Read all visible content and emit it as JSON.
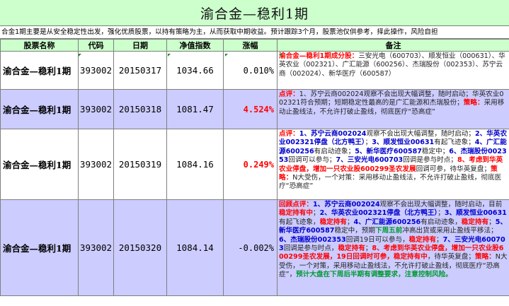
{
  "title": "渝合金—稳利1期",
  "description": "合金1期主要是从安全稳定性出发，强化优质股票，以持有策略为主，从而获取中期收益。预计跟踪3个月，股票池仅供参考，择此操作，风险自担",
  "headers": [
    "股票名称",
    "代码",
    "日期",
    "净值指数",
    "涨幅",
    "备注"
  ],
  "rows": [
    {
      "name": "渝合金—稳利1期",
      "code": "393002",
      "date": "20150317",
      "index": "1034.66",
      "change": "0.010%",
      "note": [
        {
          "t": "渝合金—稳利1期成分股：",
          "c": "red"
        },
        {
          "t": "三安光电（600703）、顺发恒业（000631）、华英农业（002321）、广汇能源（600256）、杰瑞股份（002353）、苏宁云商（002024）、新华医疗（600587）",
          "c": "plain"
        }
      ]
    },
    {
      "name": "渝合金—稳利1期",
      "code": "393002",
      "date": "20150318",
      "index": "1081.47",
      "change": "4.524%",
      "note": [
        {
          "t": "点评：",
          "c": "red"
        },
        {
          "t": "1、苏宁云商002024观察不会出现大幅调整，随时启动；华英农业002321符合预期；短期稳定性最高的是广汇能源和杰瑞股份；",
          "c": "plain"
        },
        {
          "t": "策略：",
          "c": "red"
        },
        {
          "t": "采用移动止盈线法，不允许打破止盈线，彻底医疗“恐高症”",
          "c": "plain"
        }
      ]
    },
    {
      "name": "渝合金—稳利1期",
      "code": "393002",
      "date": "20150319",
      "index": "1084.16",
      "change": "0.249%",
      "note": [
        {
          "t": "点评：",
          "c": "red"
        },
        {
          "t": "1、苏宁云商002024",
          "c": "blue"
        },
        {
          "t": "观察不会出现大幅调整，随时启动；",
          "c": "plain"
        },
        {
          "t": "2、华英农业002321停盘（北方鸭王）",
          "c": "blue"
        },
        {
          "t": "；",
          "c": "plain"
        },
        {
          "t": "3、顺发恒业00631",
          "c": "blue"
        },
        {
          "t": "有起飞迹象；",
          "c": "plain"
        },
        {
          "t": "4、广汇能源600256",
          "c": "blue"
        },
        {
          "t": "有启动迹象；",
          "c": "plain"
        },
        {
          "t": "5、新华医疗600587",
          "c": "blue"
        },
        {
          "t": "稳定中；",
          "c": "plain"
        },
        {
          "t": "6、杰瑞股份002353",
          "c": "blue"
        },
        {
          "t": "回调可以参与；",
          "c": "plain"
        },
        {
          "t": "7、三安光电600703",
          "c": "blue"
        },
        {
          "t": "回调是参与时点；",
          "c": "plain"
        },
        {
          "t": "8、考虑到华英农业停盘，增加一只农业股600299圣农发展",
          "c": "red"
        },
        {
          "t": "回调可参，待华英复盘；",
          "c": "plain"
        },
        {
          "t": "策略：",
          "c": "red"
        },
        {
          "t": "N大受伤，一个对策：采用移动止盈线法，不允许打破止盈线，彻底医疗“恐高症”",
          "c": "plain"
        }
      ]
    },
    {
      "name": "渝合金—稳利1期",
      "code": "393002",
      "date": "20150320",
      "index": "1084.14",
      "change": "-0.002%",
      "note": [
        {
          "t": "回顾点评：",
          "c": "red"
        },
        {
          "t": "1、苏宁云商002024",
          "c": "blue"
        },
        {
          "t": "观察不会出现大幅调整，随时启动，目前",
          "c": "plain"
        },
        {
          "t": "稳定持有中",
          "c": "red"
        },
        {
          "t": "；",
          "c": "plain"
        },
        {
          "t": "2、华英农业002321停盘（北方鸭王）",
          "c": "blue"
        },
        {
          "t": "；",
          "c": "plain"
        },
        {
          "t": "3、顺发恒业00631",
          "c": "blue"
        },
        {
          "t": "有起飞迹象，",
          "c": "plain"
        },
        {
          "t": "稳定持有",
          "c": "red"
        },
        {
          "t": "；",
          "c": "plain"
        },
        {
          "t": "4、广汇能源600256",
          "c": "blue"
        },
        {
          "t": "有启动迹象，",
          "c": "plain"
        },
        {
          "t": "稳定持有",
          "c": "red"
        },
        {
          "t": "；",
          "c": "plain"
        },
        {
          "t": "5、新华医疗600587",
          "c": "blue"
        },
        {
          "t": "稳定中，预期",
          "c": "plain"
        },
        {
          "t": "下周五前",
          "c": "green"
        },
        {
          "t": "冲高出货或采用止盈线平移法；",
          "c": "plain"
        },
        {
          "t": "6、杰瑞股份002353",
          "c": "blue"
        },
        {
          "t": "回调19日可以参与，",
          "c": "plain"
        },
        {
          "t": "稳定持有",
          "c": "red"
        },
        {
          "t": "；",
          "c": "plain"
        },
        {
          "t": "7、三安光电600703",
          "c": "blue"
        },
        {
          "t": "回调是参与时点，",
          "c": "plain"
        },
        {
          "t": "稳定持有",
          "c": "red"
        },
        {
          "t": "；",
          "c": "plain"
        },
        {
          "t": "8、考虑到华英农业停盘，增加一只农业股600299圣农发展，",
          "c": "red"
        },
        {
          "t": "19日回调时可参，",
          "c": "red"
        },
        {
          "t": "稳定持有中",
          "c": "red"
        },
        {
          "t": "，待华英复盘；",
          "c": "plain"
        },
        {
          "t": "策略：",
          "c": "red"
        },
        {
          "t": "N大受伤，一个对策，采用移动止盈线法，不允许打破止盈线，彻底医疗“恐高症”，",
          "c": "plain"
        },
        {
          "t": "预计大盘在下周后半期有调整要求，注意控制风险。",
          "c": "green"
        }
      ]
    }
  ]
}
